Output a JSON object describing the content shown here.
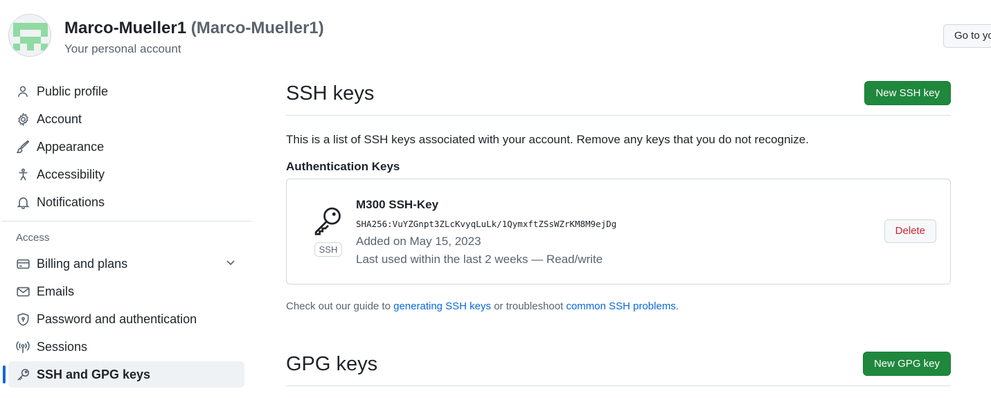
{
  "header": {
    "display_name": "Marco-Mueller1",
    "login": "(Marco-Mueller1)",
    "subtitle": "Your personal account",
    "goto_button": "Go to your personal profile"
  },
  "sidebar": {
    "items": [
      {
        "label": "Public profile",
        "icon": "person-icon"
      },
      {
        "label": "Account",
        "icon": "gear-icon"
      },
      {
        "label": "Appearance",
        "icon": "paintbrush-icon"
      },
      {
        "label": "Accessibility",
        "icon": "accessibility-icon"
      },
      {
        "label": "Notifications",
        "icon": "bell-icon"
      }
    ],
    "access_label": "Access",
    "access_items": [
      {
        "label": "Billing and plans",
        "icon": "credit-card-icon"
      },
      {
        "label": "Emails",
        "icon": "mail-icon"
      },
      {
        "label": "Password and authentication",
        "icon": "shield-lock-icon"
      },
      {
        "label": "Sessions",
        "icon": "broadcast-icon"
      },
      {
        "label": "SSH and GPG keys",
        "icon": "key-icon",
        "active": true
      }
    ]
  },
  "ssh": {
    "title": "SSH keys",
    "new_button": "New SSH key",
    "intro": "This is a list of SSH keys associated with your account. Remove any keys that you do not recognize.",
    "auth_heading": "Authentication Keys",
    "key": {
      "badge": "SSH",
      "title": "M300 SSH-Key",
      "fingerprint": "SHA256:VuYZGnpt3ZLcKvyqLuLk/1QymxftZSsWZrKM8M9ejDg",
      "added": "Added on May 15, 2023",
      "last_used": "Last used within the last 2 weeks — Read/write",
      "delete_button": "Delete"
    },
    "guide": {
      "prefix": "Check out our guide to ",
      "link1": "generating SSH keys",
      "middle": " or troubleshoot ",
      "link2": "common SSH problems",
      "suffix": "."
    }
  },
  "gpg": {
    "title": "GPG keys",
    "new_button": "New GPG key"
  },
  "colors": {
    "primary_green": "#1f883d",
    "link_blue": "#0969da",
    "danger_red": "#d1242f",
    "active_indicator": "#0969da"
  }
}
